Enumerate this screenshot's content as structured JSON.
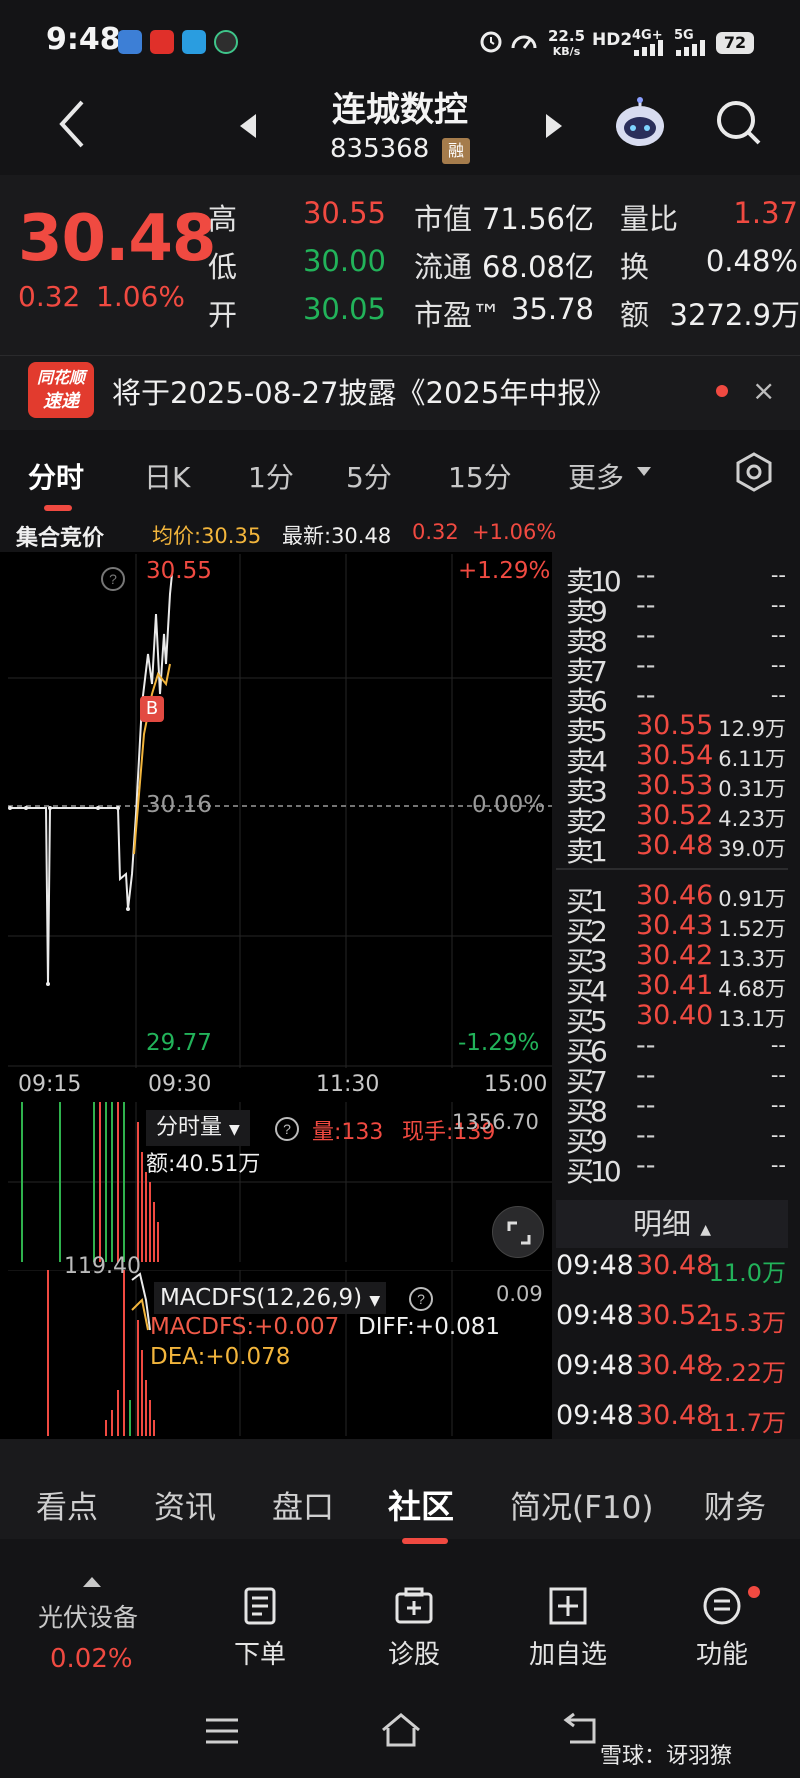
{
  "status_bar": {
    "time": "9:48",
    "speed": "22.5",
    "speed_unit": "KB/s",
    "hd": "HD2",
    "net1": "4G+",
    "net2": "5G",
    "battery": "72"
  },
  "header": {
    "stock_name": "连城数控",
    "stock_code": "835368",
    "badge": "融"
  },
  "quote": {
    "price": "30.48",
    "change": "0.32",
    "change_pct": "1.06%",
    "high_label": "高",
    "high": "30.55",
    "low_label": "低",
    "low": "30.00",
    "open_label": "开",
    "open": "30.05",
    "mktcap_label": "市值",
    "mktcap": "71.56亿",
    "float_label": "流通",
    "float": "68.08亿",
    "pe_label": "市盈™",
    "pe": "35.78",
    "vr_label": "量比",
    "vr": "1.37",
    "turnover_label": "换",
    "turnover": "0.48%",
    "amount_label": "额",
    "amount": "3272.9万"
  },
  "notice": {
    "logo_top": "同花顺",
    "logo_bottom": "速递",
    "text": "将于2025-08-27披露《2025年中报》",
    "close": "×"
  },
  "tabs": [
    "分时",
    "日K",
    "1分",
    "5分",
    "15分",
    "更多"
  ],
  "info": {
    "auction": "集合竞价",
    "avg": "均价:30.35",
    "latest": "最新:30.48",
    "chg": "0.32",
    "pct": "+1.06%"
  },
  "chart": {
    "top_price": "30.55",
    "top_pct": "+1.29%",
    "mid_price": "30.16",
    "mid_pct": "0.00%",
    "bottom_price": "29.77",
    "bottom_pct": "-1.29%",
    "times": [
      "09:15",
      "09:30",
      "11:30",
      "15:00"
    ],
    "marker": "B",
    "vol_label": "分时量",
    "vol": "量:133",
    "hand": "现手:139",
    "vol_max": "1356.70",
    "amount": "额:40.51万",
    "macd_label": "MACDFS(12,26,9)",
    "macd_val": "MACDFS:+0.007",
    "diff": "DIFF:+0.081",
    "dea": "DEA:+0.078",
    "macd_max": "0.09",
    "vol_left": "119.40"
  },
  "orderbook": {
    "sells": [
      {
        "label": "卖10",
        "price": "--",
        "vol": "--"
      },
      {
        "label": "卖9",
        "price": "--",
        "vol": "--"
      },
      {
        "label": "卖8",
        "price": "--",
        "vol": "--"
      },
      {
        "label": "卖7",
        "price": "--",
        "vol": "--"
      },
      {
        "label": "卖6",
        "price": "--",
        "vol": "--"
      },
      {
        "label": "卖5",
        "price": "30.55",
        "vol": "12.9万"
      },
      {
        "label": "卖4",
        "price": "30.54",
        "vol": "6.11万"
      },
      {
        "label": "卖3",
        "price": "30.53",
        "vol": "0.31万"
      },
      {
        "label": "卖2",
        "price": "30.52",
        "vol": "4.23万"
      },
      {
        "label": "卖1",
        "price": "30.48",
        "vol": "39.0万"
      }
    ],
    "buys": [
      {
        "label": "买1",
        "price": "30.46",
        "vol": "0.91万"
      },
      {
        "label": "买2",
        "price": "30.43",
        "vol": "1.52万"
      },
      {
        "label": "买3",
        "price": "30.42",
        "vol": "13.3万"
      },
      {
        "label": "买4",
        "price": "30.41",
        "vol": "4.68万"
      },
      {
        "label": "买5",
        "price": "30.40",
        "vol": "13.1万"
      },
      {
        "label": "买6",
        "price": "--",
        "vol": "--"
      },
      {
        "label": "买7",
        "price": "--",
        "vol": "--"
      },
      {
        "label": "买8",
        "price": "--",
        "vol": "--"
      },
      {
        "label": "买9",
        "price": "--",
        "vol": "--"
      },
      {
        "label": "买10",
        "price": "--",
        "vol": "--"
      }
    ]
  },
  "detail": {
    "header": "明细",
    "rows": [
      {
        "time": "09:48",
        "price": "30.48",
        "vol": "11.0万",
        "dir": "green"
      },
      {
        "time": "09:48",
        "price": "30.52",
        "vol": "15.3万",
        "dir": "red"
      },
      {
        "time": "09:48",
        "price": "30.48",
        "vol": "2.22万",
        "dir": "red"
      },
      {
        "time": "09:48",
        "price": "30.48",
        "vol": "11.7万",
        "dir": "red"
      }
    ]
  },
  "bottom_tabs": [
    "看点",
    "资讯",
    "盘口",
    "社区",
    "简况(F10)",
    "财务"
  ],
  "toolbar": {
    "sector_name": "光伏设备",
    "sector_pct": "0.02%",
    "order": "下单",
    "diagnose": "诊股",
    "add_watch": "加自选",
    "function": "功能"
  },
  "watermark": "雪球：讶羽獠"
}
